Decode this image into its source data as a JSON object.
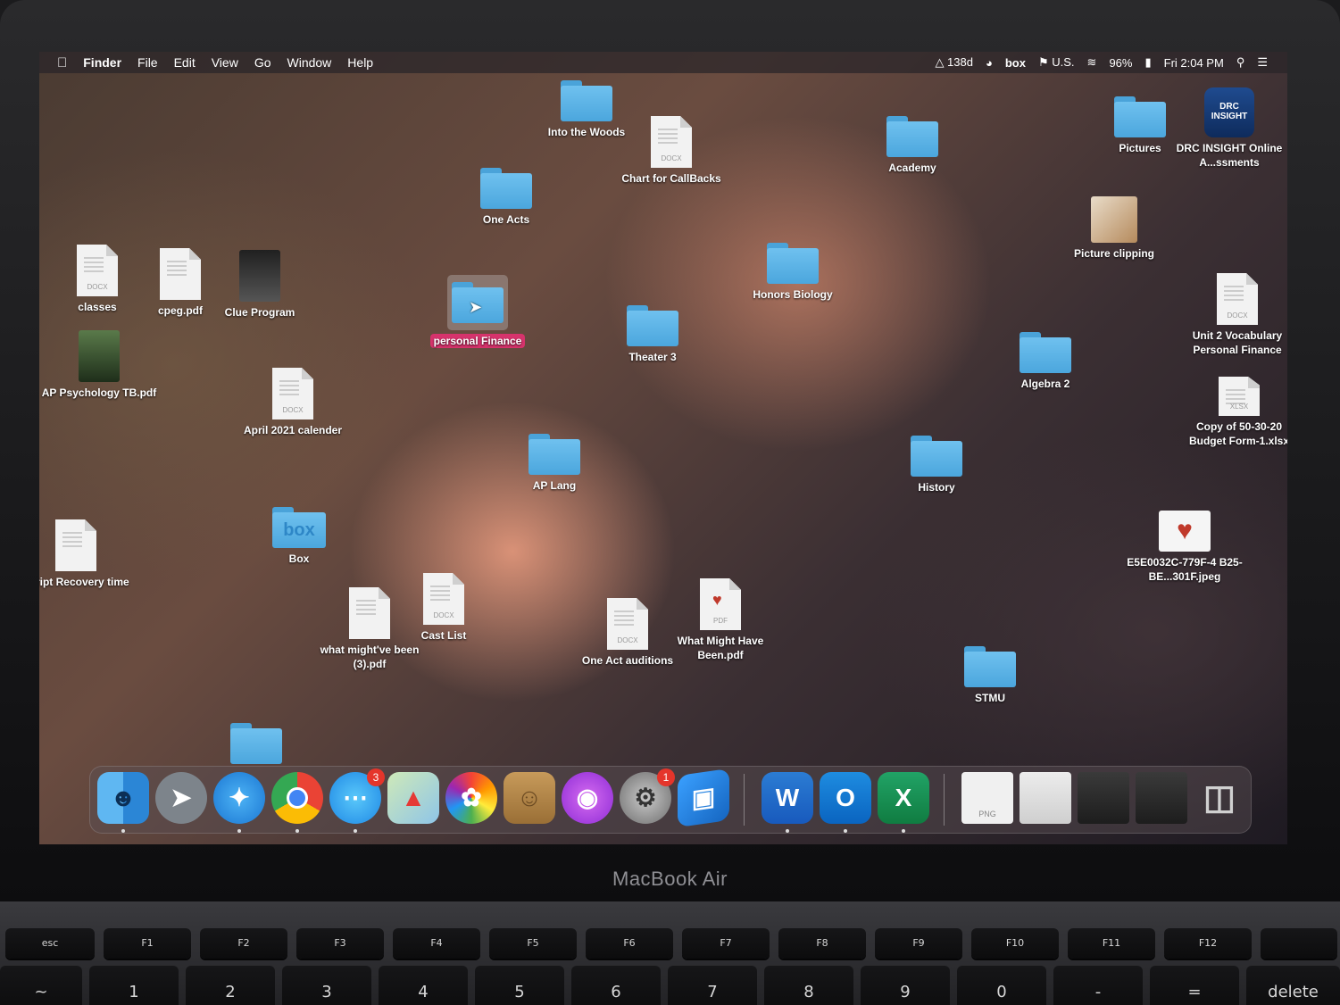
{
  "menubar": {
    "app": "Finder",
    "menus": [
      "File",
      "Edit",
      "View",
      "Go",
      "Window",
      "Help"
    ],
    "status_text": "138d",
    "box": "box",
    "input_source": "U.S.",
    "battery": "96%",
    "clock": "Fri 2:04 PM"
  },
  "desktop": {
    "into_the_woods": "Into the Woods",
    "chart_for_callbacks": "Chart for CallBacks",
    "academy": "Academy",
    "pictures": "Pictures",
    "drc_insight": "DRC INSIGHT Online A...ssments",
    "drc_icon_text": "DRC INSIGHT",
    "one_acts": "One Acts",
    "picture_clipping": "Picture clipping",
    "classes": "classes",
    "cpeg": "cpeg.pdf",
    "clue_program": "Clue Program",
    "personal_finance": "personal Finance",
    "honors_biology": "Honors Biology",
    "unit2_vocab": "Unit 2 Vocabulary Personal Finance",
    "theater3": "Theater 3",
    "algebra2": "Algebra 2",
    "ap_psych": "AP Psychology TB.pdf",
    "april_2021": "April 2021 calender",
    "copy_budget": "Copy of 50-30-20 Budget Form-1.xlsx",
    "ap_lang": "AP Lang",
    "history": "History",
    "box_folder": "Box",
    "script_recovery": "Script Recovery time",
    "e5e_jpeg": "E5E0032C-779F-4 B25-BE...301F.jpeg",
    "cast_list": "Cast List",
    "what_mightve": "what might've been (3).pdf",
    "one_act_auditions": "One Act auditions",
    "what_might_have": "What Might Have Been.pdf",
    "stmu": "STMU"
  },
  "ext": {
    "docx": "DOCX",
    "xlsx": "XLSX",
    "pdf": "PDF",
    "png": "PNG"
  },
  "dock": {
    "messages_badge": "3",
    "prefs_badge": "1"
  },
  "laptop": {
    "brand": "MacBook Air"
  }
}
